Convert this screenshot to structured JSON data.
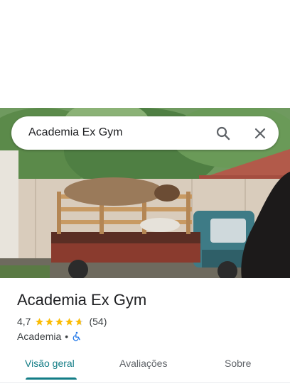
{
  "search": {
    "query": "Academia Ex Gym"
  },
  "place": {
    "name": "Academia Ex Gym",
    "rating": "4,7",
    "rating_stars": 4.7,
    "reviews": "(54)",
    "category": "Academia",
    "separator": "•"
  },
  "tabs": [
    {
      "label": "Visão geral",
      "active": true
    },
    {
      "label": "Avaliações",
      "active": false
    },
    {
      "label": "Sobre",
      "active": false
    }
  ],
  "icons": {
    "search": "search-icon",
    "close": "close-icon",
    "star": "star-icon",
    "wheelchair": "wheelchair-accessible-icon"
  },
  "colors": {
    "accent": "#137d86",
    "star": "#fbbc04",
    "wheelchair": "#1a73e8",
    "text": "#202124",
    "secondary": "#5f6368"
  }
}
